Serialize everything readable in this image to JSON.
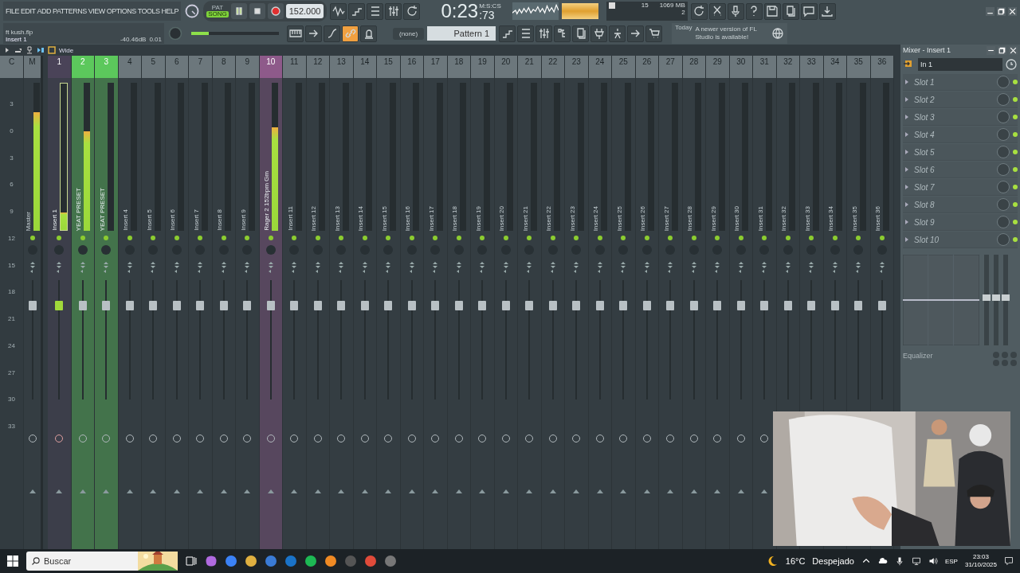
{
  "menu": [
    "FILE",
    "EDIT",
    "ADD",
    "PATTERNS",
    "VIEW",
    "OPTIONS",
    "TOOLS",
    "HELP"
  ],
  "transport": {
    "modes": [
      {
        "label": "PAT",
        "selected": false
      },
      {
        "label": "SONG",
        "selected": true
      }
    ],
    "playing": true,
    "tempo": "152.000"
  },
  "time": {
    "main": "0:23",
    "centiseconds": ":73",
    "units": "M:S:CS"
  },
  "monitor": {
    "cpu": "15",
    "memory": "1069 MB",
    "polyphony": "2"
  },
  "project": {
    "file": "ft kush.flp",
    "focus": "Insert 1",
    "readout": "-40.46dB",
    "value": "0.01"
  },
  "master_volume": {
    "level": 0.2
  },
  "tool_toggles": [
    {
      "on": false
    },
    {
      "on": false
    },
    {
      "on": false
    },
    {
      "on": true
    },
    {
      "on": false
    }
  ],
  "pattern": {
    "snap": "(none)",
    "name": "Pattern 1"
  },
  "news": {
    "date": "Today",
    "message": "A newer version of FL Studio is available!"
  },
  "mixer": {
    "view": "Wide",
    "current_label": "C",
    "scale": [
      "3",
      "0",
      "3",
      "6",
      "9",
      "12",
      "15",
      "18",
      "21",
      "24",
      "27",
      "30",
      "33"
    ],
    "tracks": [
      {
        "number": "M",
        "name": "Master",
        "level": 0.8,
        "selected": false
      },
      {
        "number": "1",
        "name": "Insert 1",
        "level": 0.12,
        "selected": true,
        "color": "#4a4358"
      },
      {
        "number": "2",
        "name": "YEAT PRESET",
        "level": 0.67,
        "selected": false,
        "color": "#5cc85c"
      },
      {
        "number": "3",
        "name": "YEAT PRESET",
        "selected": false,
        "color": "#5cc85c"
      },
      {
        "number": "4",
        "name": "Insert 4",
        "selected": false
      },
      {
        "number": "5",
        "name": "Insert 5",
        "selected": false
      },
      {
        "number": "6",
        "name": "Insert 6",
        "selected": false
      },
      {
        "number": "7",
        "name": "Insert 7",
        "selected": false
      },
      {
        "number": "8",
        "name": "Insert 8",
        "selected": false
      },
      {
        "number": "9",
        "name": "Insert 9",
        "selected": false
      },
      {
        "number": "10",
        "name": "Rager 2 152bpm Gm",
        "level": 0.7,
        "selected": false,
        "color": "#8e5a8a"
      },
      {
        "number": "11",
        "name": "Insert 11",
        "selected": false
      },
      {
        "number": "12",
        "name": "Insert 12",
        "selected": false
      },
      {
        "number": "13",
        "name": "Insert 13",
        "selected": false
      },
      {
        "number": "14",
        "name": "Insert 14",
        "selected": false
      },
      {
        "number": "15",
        "name": "Insert 15",
        "selected": false
      },
      {
        "number": "16",
        "name": "Insert 16",
        "selected": false
      },
      {
        "number": "17",
        "name": "Insert 17",
        "selected": false
      },
      {
        "number": "18",
        "name": "Insert 18",
        "selected": false
      },
      {
        "number": "19",
        "name": "Insert 19",
        "selected": false
      },
      {
        "number": "20",
        "name": "Insert 20",
        "selected": false
      },
      {
        "number": "21",
        "name": "Insert 21",
        "selected": false
      },
      {
        "number": "22",
        "name": "Insert 22",
        "selected": false
      },
      {
        "number": "23",
        "name": "Insert 23",
        "selected": false
      },
      {
        "number": "24",
        "name": "Insert 24",
        "selected": false
      },
      {
        "number": "25",
        "name": "Insert 25",
        "selected": false
      },
      {
        "number": "26",
        "name": "Insert 26",
        "selected": false
      },
      {
        "number": "27",
        "name": "Insert 27",
        "selected": false
      },
      {
        "number": "28",
        "name": "Insert 28",
        "selected": false
      },
      {
        "number": "29",
        "name": "Insert 29",
        "selected": false
      },
      {
        "number": "30",
        "name": "Insert 30",
        "selected": false
      },
      {
        "number": "31",
        "name": "Insert 31",
        "selected": false
      },
      {
        "number": "32",
        "name": "Insert 32",
        "selected": false
      },
      {
        "number": "33",
        "name": "Insert 33",
        "selected": false
      },
      {
        "number": "34",
        "name": "Insert 34",
        "selected": false
      },
      {
        "number": "35",
        "name": "Insert 35",
        "selected": false
      },
      {
        "number": "36",
        "name": "Insert 36",
        "selected": false
      }
    ]
  },
  "panel": {
    "title": "Mixer - Insert 1",
    "input": "In 1",
    "eq_label": "Equalizer",
    "slots": [
      {
        "label": "Slot 1",
        "on": true
      },
      {
        "label": "Slot 2",
        "on": true
      },
      {
        "label": "Slot 3",
        "on": true
      },
      {
        "label": "Slot 4",
        "on": true
      },
      {
        "label": "Slot 5",
        "on": true
      },
      {
        "label": "Slot 6",
        "on": true
      },
      {
        "label": "Slot 7",
        "on": true
      },
      {
        "label": "Slot 8",
        "on": true
      },
      {
        "label": "Slot 9",
        "on": true
      },
      {
        "label": "Slot 10",
        "on": true
      }
    ]
  },
  "taskbar": {
    "search_placeholder": "Buscar",
    "temperature": "16°C",
    "weather": "Despejado",
    "language": "ESP",
    "time": "23:03",
    "date": "31/10/2025"
  }
}
